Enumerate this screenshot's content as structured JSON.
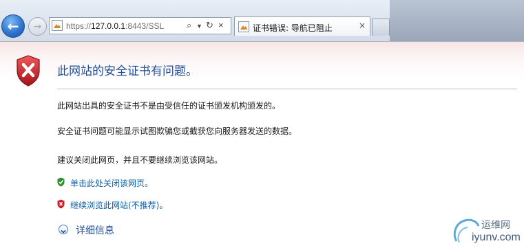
{
  "browser": {
    "address_bar": {
      "url_prefix": "https://",
      "url_host": "127.0.0.1",
      "url_rest": ":8443/SSL"
    },
    "tab": {
      "title": "证书错误: 导航已阻止",
      "close_glyph": "×"
    }
  },
  "page": {
    "heading": "此网站的安全证书有问题。",
    "paragraphs": [
      "此网站出具的安全证书不是由受信任的证书颁发机构颁发的。",
      "安全证书问题可能显示试图欺骗您或截获您向服务器发送的数据。",
      "建议关闭此网页，并且不要继续浏览该网站。"
    ],
    "options": [
      {
        "label": "单击此处关闭该网页。",
        "icon": "green-shield-check-icon"
      },
      {
        "label": "继续浏览此网站(不推荐)。",
        "icon": "red-shield-x-icon"
      }
    ],
    "more_info": "详细信息"
  },
  "watermark": {
    "line1": "运维网",
    "line2": "iyunv.com"
  },
  "colors": {
    "heading": "#1f4e99",
    "link": "#0a5fa8",
    "shield_red": "#c8222a",
    "shield_green": "#2e8f2e"
  }
}
